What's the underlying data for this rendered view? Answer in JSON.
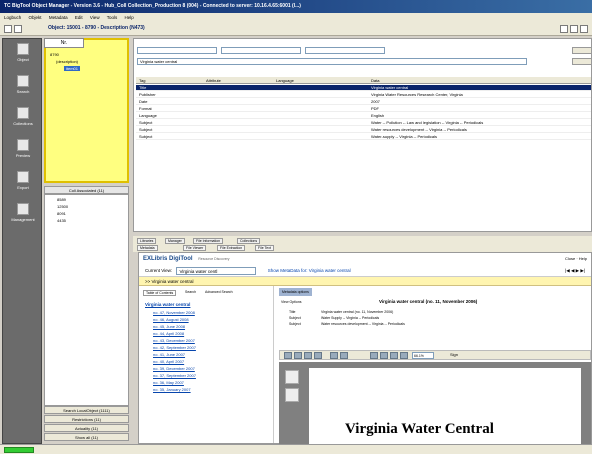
{
  "window": {
    "title": "TC BigTool Object Manager - Version 3.6 - Hub_Coll Collection_Production 8 (004) - Connected to server: 10.16.4.65:6001 (l...)"
  },
  "menu": [
    "Logbuch",
    "Objekt",
    "Metadata",
    "Edit",
    "View",
    "Tools",
    "Help"
  ],
  "object_title": "Object: 15001 - 8790 - Description (N473)",
  "sidebar": {
    "items": [
      "Object",
      "Search",
      "Collections",
      "Preview",
      "Export",
      "Management"
    ]
  },
  "tree": {
    "tab": "Nr.",
    "items": [
      "8790",
      "(description)",
      "item01"
    ]
  },
  "list": {
    "header": "Coll Associated (11)",
    "items": [
      "8589",
      "12500",
      "8091",
      "4435"
    ]
  },
  "bottom_buttons": [
    "Search LocalObject (1111)",
    "Restrictions (11)",
    "Actuality (11)",
    "Show all (11)"
  ],
  "main": {
    "filter_value": "Virginia water central",
    "columns": [
      "Tag",
      "Attribute",
      "Language",
      "Data"
    ],
    "rows": [
      {
        "tag": "Title",
        "attr": "",
        "lang": "",
        "data": "Virginia water central"
      },
      {
        "tag": "Publisher",
        "attr": "",
        "lang": "",
        "data": "Virginia Water Resources Research Center, Virginia"
      },
      {
        "tag": "Date",
        "attr": "",
        "lang": "",
        "data": "2007"
      },
      {
        "tag": "Format",
        "attr": "",
        "lang": "",
        "data": "PDF"
      },
      {
        "tag": "Language",
        "attr": "",
        "lang": "",
        "data": "English"
      },
      {
        "tag": "Subject",
        "attr": "",
        "lang": "",
        "data": "Water -- Pollution -- Law and legislation -- Virginia -- Periodicals"
      },
      {
        "tag": "Subject",
        "attr": "",
        "lang": "",
        "data": "Water resources development -- Virginia -- Periodicals"
      },
      {
        "tag": "Subject",
        "attr": "",
        "lang": "",
        "data": "Water-supply -- Virginia -- Periodicals"
      }
    ]
  },
  "tabs": [
    "Libraries",
    "Manager",
    "File Information",
    "Collections"
  ],
  "subtabs": [
    "Metadata",
    "File Viewer",
    "File Extraction",
    "File Text"
  ],
  "viewer": {
    "logo": "EXLibris DigiTool",
    "logo_sub": "Resource Discovery",
    "top_right": "Close · Help",
    "current_view_label": "Current View:",
    "current_view_value": "Virginia water centl",
    "show_metadata": "Show MetaData for: Virginia water central",
    "pager": "|◀ ◀ ▶ ▶|",
    "tip": ">> Virginia water central",
    "toc_tabs": [
      "Table of Contents",
      "Search",
      "Advanced Search"
    ],
    "toc_root": "Virginia water central",
    "toc_items": [
      "no. 47, November 2008",
      "no. 46, August 2008",
      "no. 45, June 2008",
      "no. 44, April 2008",
      "no. 43, December 2007",
      "no. 42, September 2007",
      "no. 41, June 2007",
      "no. 40, April 2007",
      "no. 39, December 2007",
      "no. 37, September 2007",
      "no. 36, May 2007",
      "no. 35, January 2007"
    ],
    "doc_title": "Virginia water central (no. 11, November 2006)",
    "view_options": "View Options",
    "metadata_options": "Metadata options",
    "meta": [
      {
        "k": "Title",
        "v": "Virginia water central (no. 11, November 2006)"
      },
      {
        "k": "Subject",
        "v": "Water Supply -- Virginia -- Periodicals"
      },
      {
        "k": "Subject",
        "v": "Water resources development -- Virginia -- Periodicals"
      }
    ],
    "zoom": "66.1%",
    "sign": "Sign",
    "pdf_title": "Virginia Water Central"
  },
  "colors": {
    "selection": "#0a246a",
    "tree_bg": "#ffff80",
    "tip_bg": "#fff5b0"
  }
}
